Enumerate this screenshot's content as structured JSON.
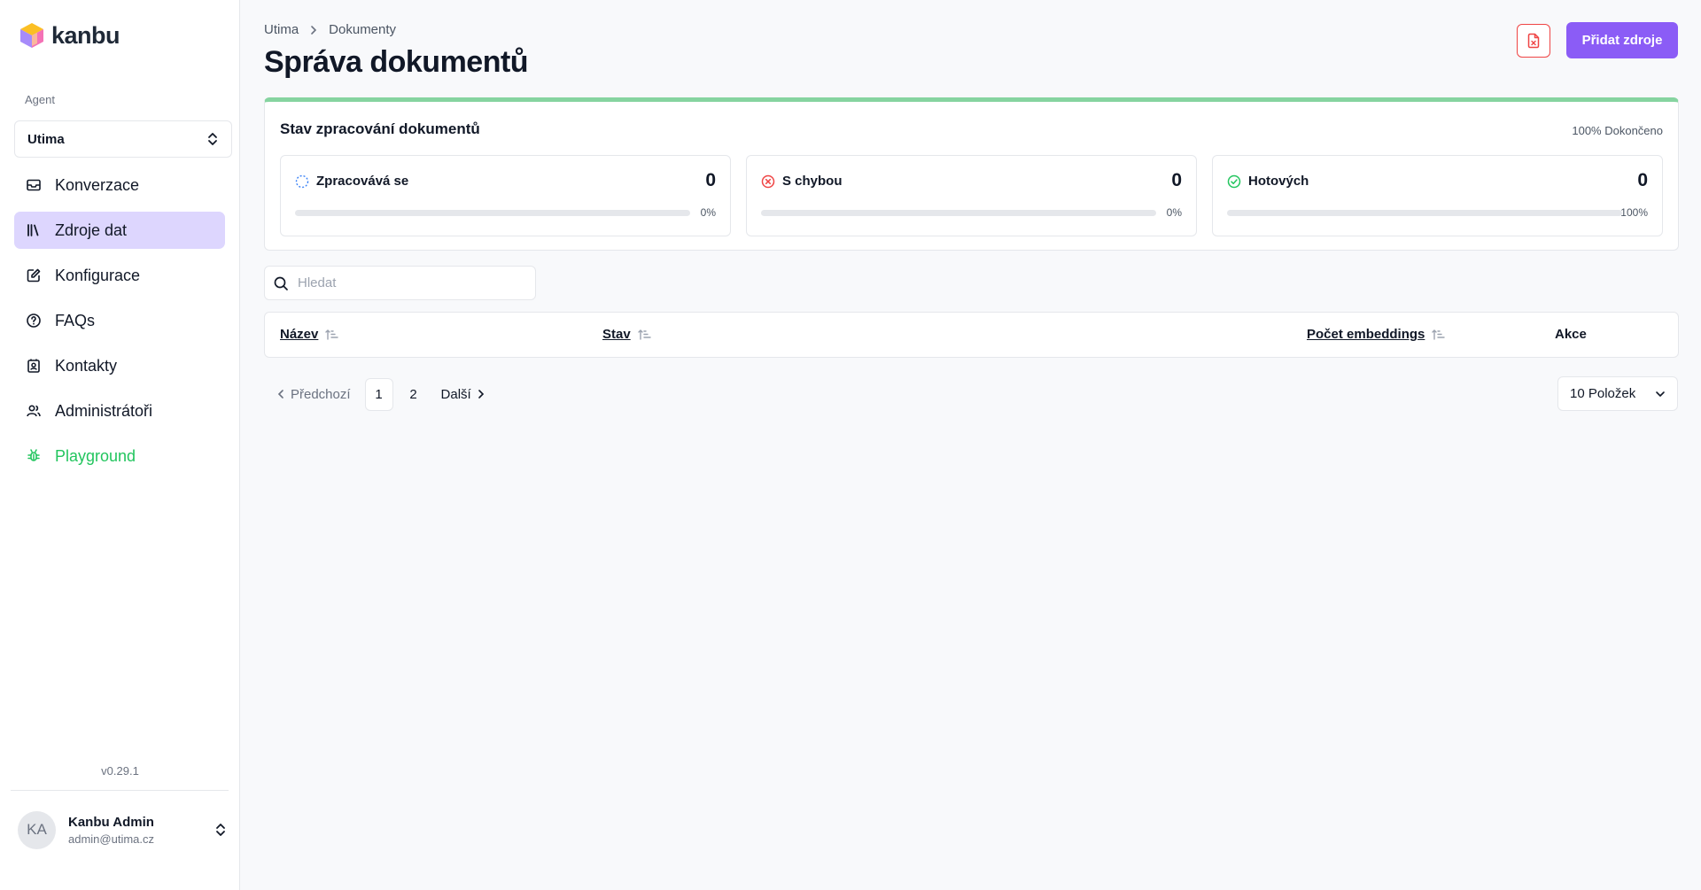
{
  "app": {
    "name": "kanbu",
    "version": "v0.29.1"
  },
  "sidebar": {
    "agent_label": "Agent",
    "agent_value": "Utima",
    "items": [
      {
        "label": "Konverzace",
        "icon": "inbox-icon"
      },
      {
        "label": "Zdroje dat",
        "icon": "library-icon",
        "active": true
      },
      {
        "label": "Konfigurace",
        "icon": "edit-icon"
      },
      {
        "label": "FAQs",
        "icon": "help-circle-icon"
      },
      {
        "label": "Kontakty",
        "icon": "contact-icon"
      },
      {
        "label": "Administrátoři",
        "icon": "users-icon"
      },
      {
        "label": "Playground",
        "icon": "bug-icon",
        "color": "#22c55e"
      }
    ]
  },
  "user": {
    "initials": "KA",
    "name": "Kanbu Admin",
    "email": "admin@utima.cz"
  },
  "header": {
    "breadcrumb": [
      "Utima",
      "Dokumenty"
    ],
    "title": "Správa dokumentů",
    "add_button": "Přidat zdroje"
  },
  "status": {
    "title": "Stav zpracování dokumentů",
    "complete": "100% Dokončeno",
    "complete_fraction": 1.0,
    "cards": [
      {
        "label": "Zpracovává se",
        "count": "0",
        "percent": "0%",
        "fill": 0,
        "icon": "loader-icon",
        "color": "#3b82f6"
      },
      {
        "label": "S chybou",
        "count": "0",
        "percent": "0%",
        "fill": 0,
        "icon": "error-circle-icon",
        "color": "#ef4444"
      },
      {
        "label": "Hotových",
        "count": "0",
        "percent": "100%",
        "fill": 0,
        "icon": "check-circle-icon",
        "color": "#22c55e"
      }
    ]
  },
  "search": {
    "placeholder": "Hledat"
  },
  "table": {
    "columns": [
      "Název",
      "Stav",
      "Počet embeddings",
      "Akce"
    ]
  },
  "pagination": {
    "prev": "Předchozí",
    "next": "Další",
    "pages": [
      "1",
      "2"
    ],
    "current": "1",
    "per_page": "10 Položek"
  },
  "colors": {
    "accent": "#8b5cf6",
    "active_nav": "#ddd6fe",
    "success": "#86d4a0",
    "danger": "#ef4444"
  }
}
